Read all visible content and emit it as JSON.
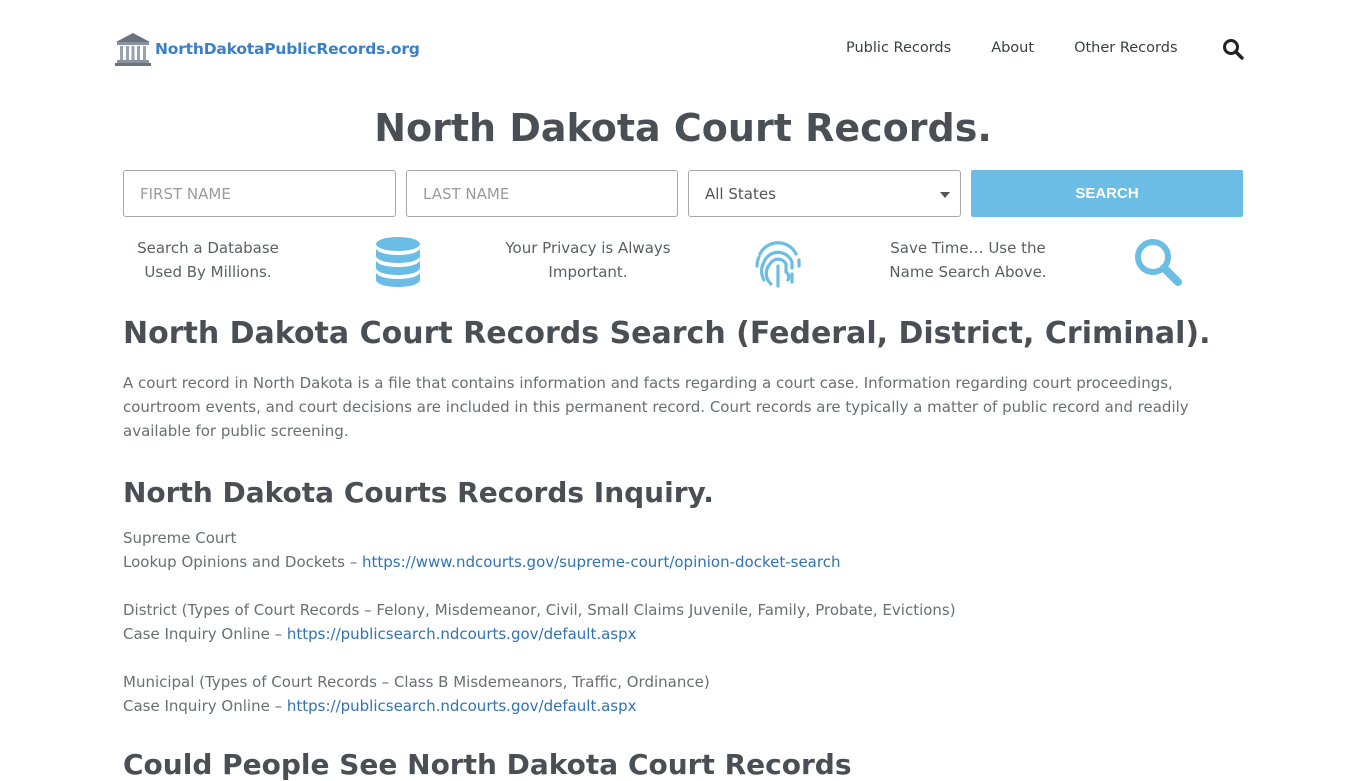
{
  "header": {
    "logo_text": "NorthDakotaPublicRecords.org",
    "nav": [
      "Public Records",
      "About",
      "Other Records"
    ]
  },
  "title": "North Dakota Court Records.",
  "search": {
    "first_placeholder": "FIRST NAME",
    "last_placeholder": "LAST NAME",
    "state_value": "All States",
    "button_label": "SEARCH"
  },
  "features": [
    {
      "line1": "Search a Database",
      "line2": "Used By Millions.",
      "icon": "database-icon"
    },
    {
      "line1": "Your Privacy is Always",
      "line2": "Important.",
      "icon": "fingerprint-icon"
    },
    {
      "line1": "Save Time… Use the",
      "line2": "Name Search Above.",
      "icon": "search-icon"
    }
  ],
  "accent_color": "#6cbde5",
  "link_color": "#2f73b7",
  "main": {
    "heading1": "North Dakota Court Records Search (Federal, District, Criminal).",
    "paragraph": "A court record in North Dakota is a file that contains information and facts regarding a court case. Information regarding court proceedings, courtroom events, and court decisions are included in this permanent record. Court records are typically a matter of public record and readily available for public screening.",
    "heading2": "North Dakota Courts Records Inquiry.",
    "supreme_title": "Supreme Court",
    "supreme_label": "Lookup Opinions and Dockets –",
    "supreme_link": "https://www.ndcourts.gov/supreme-court/opinion-docket-search",
    "district_title": "District (Types of Court Records – Felony, Misdemeanor, Civil, Small Claims Juvenile, Family, Probate, Evictions)",
    "district_label": "Case Inquiry Online  –",
    "district_link": "https://publicsearch.ndcourts.gov/default.aspx",
    "municipal_title": "Municipal (Types of Court Records – Class B Misdemeanors, Traffic, Ordinance)",
    "municipal_label": "Case Inquiry Online –",
    "municipal_link": "https://publicsearch.ndcourts.gov/default.aspx",
    "heading3": "Could People See North Dakota Court Records"
  }
}
